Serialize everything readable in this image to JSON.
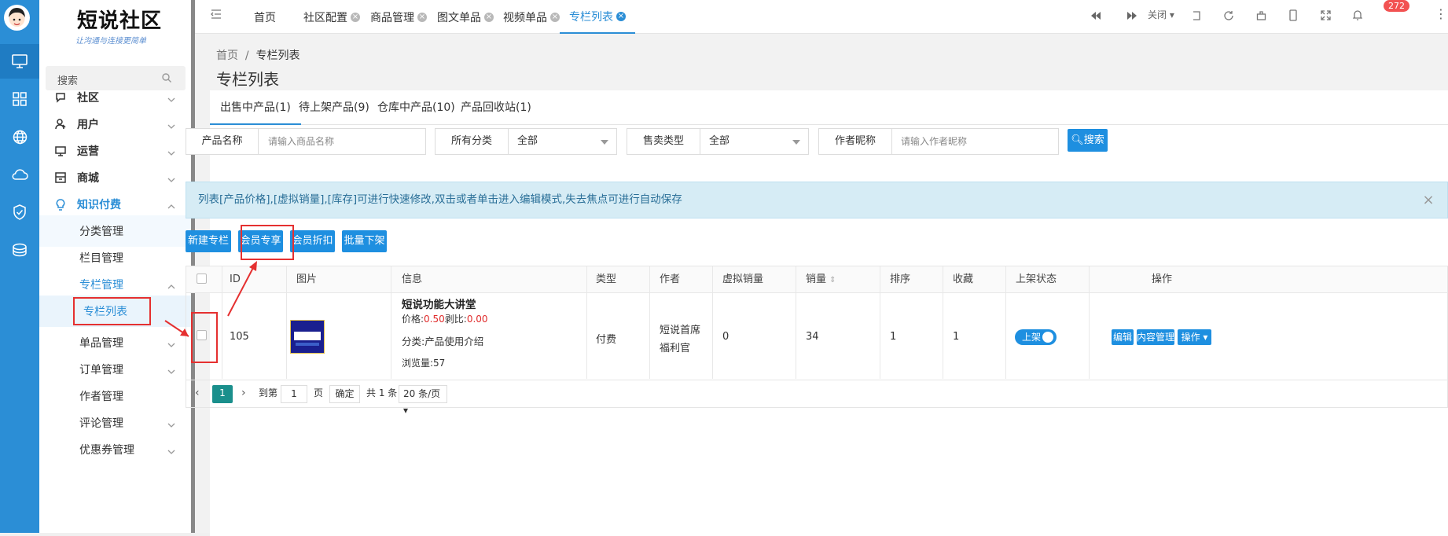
{
  "rail": {
    "icons": [
      "monitor-icon",
      "grid-icon",
      "globe-icon",
      "cloud-icon",
      "shield-check-icon",
      "database-icon"
    ]
  },
  "sidebar": {
    "logo_title": "短说社区",
    "logo_slogan": "让沟通与连接更简单",
    "search_placeholder": "搜索",
    "items": [
      {
        "label": "社区"
      },
      {
        "label": "用户"
      },
      {
        "label": "运营"
      },
      {
        "label": "商城"
      },
      {
        "label": "知识付费"
      },
      {
        "label": "分类管理"
      },
      {
        "label": "栏目管理"
      },
      {
        "label": "专栏管理"
      },
      {
        "label": "专栏列表"
      },
      {
        "label": "单品管理"
      },
      {
        "label": "订单管理"
      },
      {
        "label": "作者管理"
      },
      {
        "label": "评论管理"
      },
      {
        "label": "优惠券管理"
      }
    ]
  },
  "tabs": [
    {
      "label": "首页"
    },
    {
      "label": "社区配置"
    },
    {
      "label": "商品管理"
    },
    {
      "label": "图文单品"
    },
    {
      "label": "视频单品"
    },
    {
      "label": "专栏列表"
    }
  ],
  "toolbar": {
    "close_label": "关闭",
    "notif_count": "272"
  },
  "breadcrumb": {
    "home": "首页",
    "sep": "/",
    "current": "专栏列表"
  },
  "page_title": "专栏列表",
  "product_tabs": [
    {
      "label": "出售中产品(1)"
    },
    {
      "label": "待上架产品(9)"
    },
    {
      "label": "仓库中产品(10)"
    },
    {
      "label": "产品回收站(1)"
    }
  ],
  "filters": {
    "name_label": "产品名称",
    "name_placeholder": "请输入商品名称",
    "cat_label": "所有分类",
    "cat_value": "全部",
    "sale_label": "售卖类型",
    "sale_value": "全部",
    "author_label": "作者昵称",
    "author_placeholder": "请输入作者昵称",
    "search_btn": "搜索"
  },
  "alert": "列表[产品价格],[虚拟销量],[库存]可进行快速修改,双击或者单击进入编辑模式,失去焦点可进行自动保存",
  "actions": [
    "新建专栏",
    "会员专享",
    "会员折扣",
    "批量下架"
  ],
  "table": {
    "headers": [
      "ID",
      "图片",
      "信息",
      "类型",
      "作者",
      "虚拟销量",
      "销量",
      "排序",
      "收藏",
      "上架状态",
      "操作"
    ],
    "row": {
      "id": "105",
      "title": "短说功能大讲堂",
      "price_label": "价格:",
      "price": "0.50",
      "ratio_label": "剥比:",
      "ratio": "0.00",
      "category": "分类:产品使用介绍",
      "views": "浏览量:57",
      "type": "付费",
      "author_line1": "短说首席",
      "author_line2": "福利官",
      "virtual_sales": "0",
      "sales": "34",
      "sort": "1",
      "favorites": "1",
      "status": "上架",
      "ops": [
        "编辑",
        "内容管理",
        "操作"
      ]
    }
  },
  "pagination": {
    "page": "1",
    "goto_label": "到第",
    "goto_value": "1",
    "page_unit": "页",
    "confirm": "确定",
    "total": "共 1 条",
    "per_page": "20 条/页"
  },
  "accent": "#2b8ed6"
}
